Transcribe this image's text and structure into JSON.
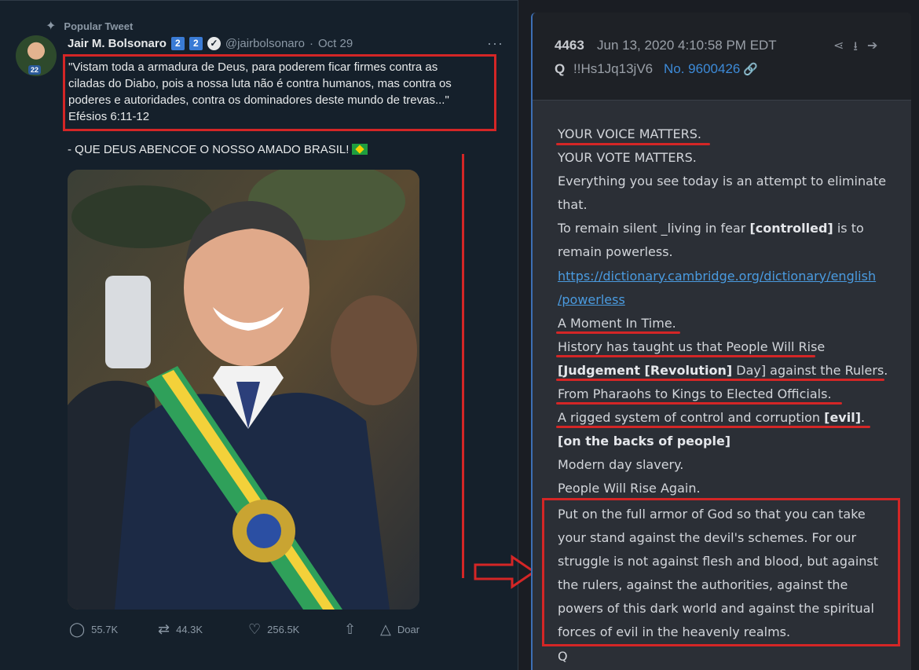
{
  "tweet": {
    "popular_label": "Popular Tweet",
    "author_name": "Jair M. Bolsonaro",
    "badge_1": "2",
    "badge_2": "2",
    "avatar_badge": "22",
    "handle": "@jairbolsonaro",
    "separator": "·",
    "date": "Oct 29",
    "quote_lines": [
      "\"Vistam toda a armadura de Deus, para poderem ficar firmes contra as",
      "ciladas do Diabo, pois a nossa luta não é contra humanos, mas contra os",
      "poderes e autoridades, contra os dominadores deste mundo de trevas...\"",
      "Efésios 6:11-12"
    ],
    "tagline": "- QUE DEUS ABENCOE O NOSSO AMADO BRASIL!",
    "actions": {
      "replies": "55.7K",
      "retweets": "44.3K",
      "likes": "256.5K",
      "donate": "Doar"
    }
  },
  "q_post": {
    "number": "4463",
    "date": "Jun 13, 2020 4:10:58 PM EDT",
    "name": "Q",
    "tripcode": "!!Hs1Jq13jV6",
    "post_no": "No. 9600426",
    "lines": [
      "YOUR VOICE MATTERS.",
      "YOUR VOTE MATTERS.",
      "Everything you see today is an attempt to eliminate",
      "that.",
      "To remain silent _living in fear ",
      "remain powerless.",
      "https://dictionary.cambridge.org/dictionary/english",
      "/powerless",
      "A Moment In Time.",
      "History has taught us that People Will Rise",
      "Day] against the Rulers.",
      "From Pharaohs to Kings to Elected Officials.",
      "A rigged system of control and corruption ",
      "[on the backs of people]",
      "Modern day slavery.",
      "People Will Rise Again."
    ],
    "bold_controlled": "[controlled]",
    "after_controlled": " is to",
    "bold_judgement": "[Judgement ",
    "bold_revolution": "[Revolution]",
    "bold_evil": "[evil]",
    "after_evil": ".",
    "armor_lines": [
      "Put on the full armor of God so that you can take",
      "your stand against the devil's schemes. For our",
      "struggle is not against flesh and blood, but against",
      "the rulers, against the authorities, against the",
      "powers of this dark world and against the spiritual",
      "forces of evil in the heavenly realms."
    ],
    "signature": "Q"
  }
}
